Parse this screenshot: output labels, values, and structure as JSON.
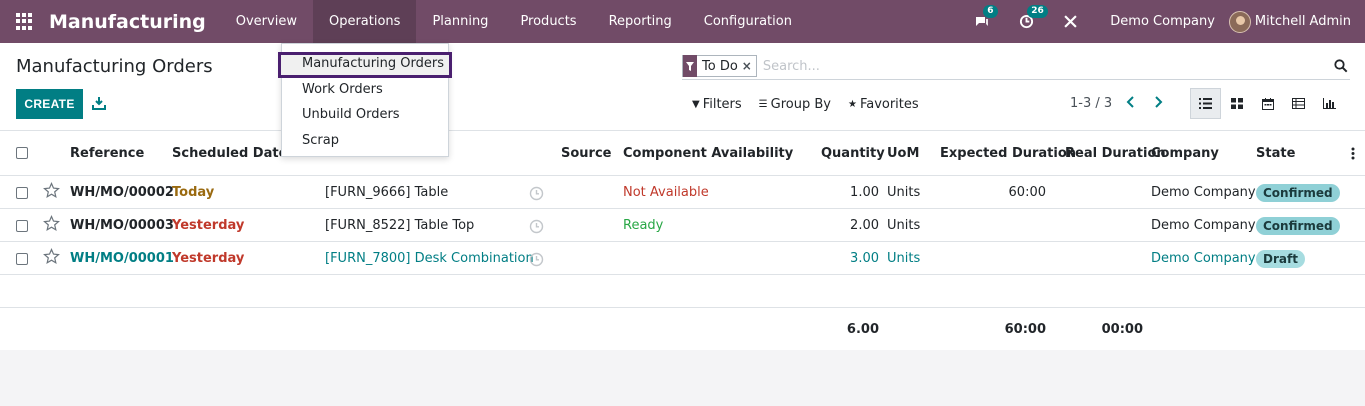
{
  "navbar": {
    "app_title": "Manufacturing",
    "menu": [
      "Overview",
      "Operations",
      "Planning",
      "Products",
      "Reporting",
      "Configuration"
    ],
    "messages_count": "6",
    "activities_count": "26",
    "company": "Demo Company",
    "user": "Mitchell Admin"
  },
  "dropdown": {
    "items": [
      "Manufacturing Orders",
      "Work Orders",
      "Unbuild Orders",
      "Scrap"
    ]
  },
  "control": {
    "breadcrumb": "Manufacturing Orders",
    "create_label": "CREATE",
    "facet": "To Do",
    "search_placeholder": "Search...",
    "filters": "Filters",
    "group_by": "Group By",
    "favorites": "Favorites",
    "pager": "1-3 / 3"
  },
  "table": {
    "headers": {
      "reference": "Reference",
      "scheduled_date": "Scheduled Date",
      "source": "Source",
      "component_availability": "Component Availability",
      "quantity": "Quantity",
      "uom": "UoM",
      "expected_duration": "Expected Duration",
      "real_duration": "Real Duration",
      "company": "Company",
      "state": "State"
    },
    "rows": [
      {
        "reference": "WH/MO/00002",
        "date": "Today",
        "product": "[FURN_9666] Table",
        "availability": "Not Available",
        "quantity": "1.00",
        "uom": "Units",
        "expected": "60:00",
        "company": "Demo Company",
        "state": "Confirmed"
      },
      {
        "reference": "WH/MO/00003",
        "date": "Yesterday",
        "product": "[FURN_8522] Table Top",
        "availability": "Ready",
        "quantity": "2.00",
        "uom": "Units",
        "expected": "",
        "company": "Demo Company",
        "state": "Confirmed"
      },
      {
        "reference": "WH/MO/00001",
        "date": "Yesterday",
        "product": "[FURN_7800] Desk Combination",
        "availability": "",
        "quantity": "3.00",
        "uom": "Units",
        "expected": "",
        "company": "Demo Company",
        "state": "Draft"
      }
    ],
    "totals": {
      "quantity": "6.00",
      "expected": "60:00",
      "real": "00:00"
    }
  },
  "colors": {
    "brand": "#714b67",
    "accent": "#017e84",
    "highlight_border": "#4a1f6f"
  }
}
